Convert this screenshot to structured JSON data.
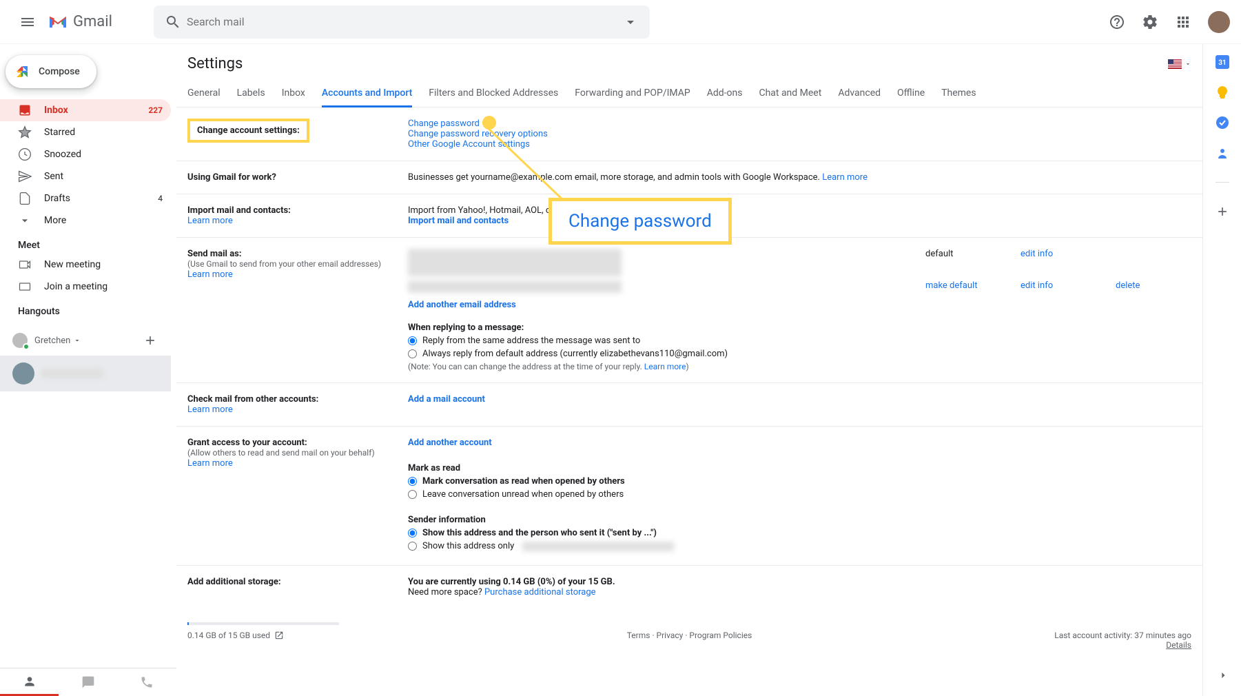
{
  "header": {
    "logo_text": "Gmail",
    "search_placeholder": "Search mail"
  },
  "compose": {
    "label": "Compose"
  },
  "nav": {
    "inbox": {
      "label": "Inbox",
      "count": "227"
    },
    "starred": {
      "label": "Starred"
    },
    "snoozed": {
      "label": "Snoozed"
    },
    "sent": {
      "label": "Sent"
    },
    "drafts": {
      "label": "Drafts",
      "count": "4"
    },
    "more": {
      "label": "More"
    }
  },
  "meet": {
    "title": "Meet",
    "new": "New meeting",
    "join": "Join a meeting"
  },
  "hangouts": {
    "title": "Hangouts",
    "user": "Gretchen"
  },
  "settings_title": "Settings",
  "tabs": {
    "general": "General",
    "labels": "Labels",
    "inbox": "Inbox",
    "accounts": "Accounts and Import",
    "filters": "Filters and Blocked Addresses",
    "forwarding": "Forwarding and POP/IMAP",
    "addons": "Add-ons",
    "chat": "Chat and Meet",
    "advanced": "Advanced",
    "offline": "Offline",
    "themes": "Themes"
  },
  "sections": {
    "change_account": {
      "label": "Change account settings:",
      "change_pw": "Change password",
      "recovery": "Change password recovery options",
      "other": "Other Google Account settings"
    },
    "work": {
      "label": "Using Gmail for work?",
      "text": "Businesses get yourname@example.com email, more storage, and admin tools with Google Workspace.",
      "learn": "Learn more"
    },
    "import": {
      "label": "Import mail and contacts:",
      "learn": "Learn more",
      "text": "Import from Yahoo!, Hotmail, AOL, or other webmail or POP3 accounts.",
      "link": "Import mail and contacts"
    },
    "send": {
      "label": "Send mail as:",
      "sub": "(Use Gmail to send from your other email addresses)",
      "learn": "Learn more",
      "default_label": "default",
      "make_default": "make default",
      "edit": "edit info",
      "delete": "delete",
      "add": "Add another email address",
      "reply_heading": "When replying to a message:",
      "reply_same": "Reply from the same address the message was sent to",
      "reply_always": "Always reply from default address (currently elizabethevans110@gmail.com)",
      "note_pre": "(Note: You can can change the address at the time of your reply. ",
      "note_learn": "Learn more",
      "note_post": ")"
    },
    "check": {
      "label": "Check mail from other accounts:",
      "learn": "Learn more",
      "add": "Add a mail account"
    },
    "grant": {
      "label": "Grant access to your account:",
      "sub": "(Allow others to read and send mail on your behalf)",
      "learn": "Learn more",
      "add": "Add another account",
      "mark_heading": "Mark as read",
      "mark_read": "Mark conversation as read when opened by others",
      "leave_unread": "Leave conversation unread when opened by others",
      "sender_heading": "Sender information",
      "show_both": "Show this address and the person who sent it (\"sent by ...\")",
      "show_only": "Show this address only"
    },
    "storage": {
      "label": "Add additional storage:",
      "using": "You are currently using 0.14 GB (0%) of your 15 GB.",
      "need": "Need more space? ",
      "purchase": "Purchase additional storage"
    }
  },
  "callout": {
    "text": "Change password"
  },
  "footer": {
    "used": "0.14 GB of 15 GB used",
    "terms": "Terms",
    "privacy": "Privacy",
    "policies": "Program Policies",
    "activity": "Last account activity: 37 minutes ago",
    "details": "Details"
  }
}
